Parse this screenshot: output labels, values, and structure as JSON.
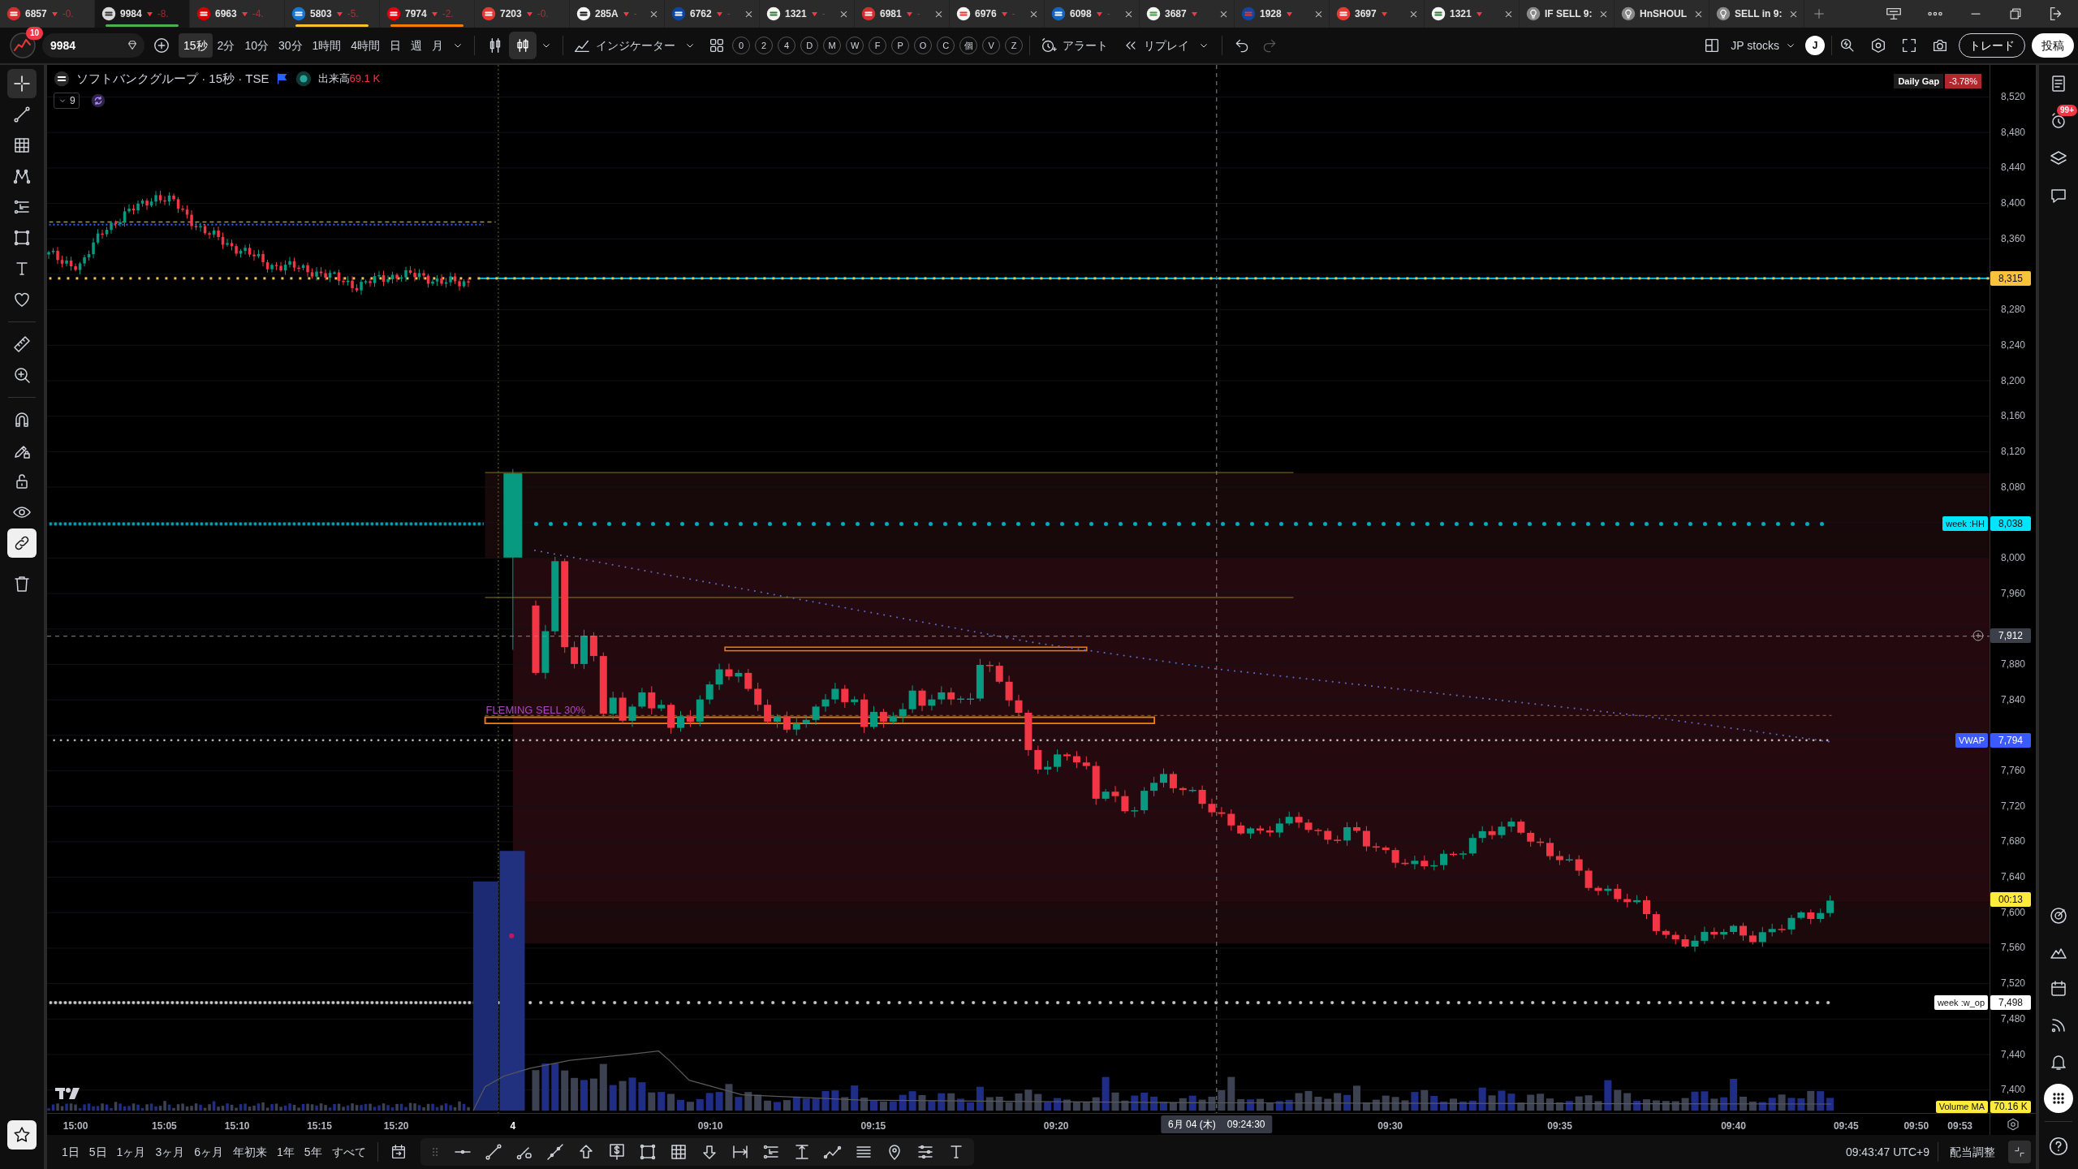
{
  "tabs": [
    {
      "kind": "symbol",
      "label": "6857",
      "change": "-0.",
      "selected": false,
      "closable": false
    },
    {
      "kind": "symbol",
      "label": "9984",
      "change": "-8.",
      "selected": true,
      "closable": false,
      "color": "#4caf50"
    },
    {
      "kind": "symbol",
      "label": "6963",
      "change": "-4.",
      "selected": false,
      "closable": false
    },
    {
      "kind": "symbol",
      "label": "5803",
      "change": "-5.",
      "selected": false,
      "closable": false,
      "color": "#fbc02d"
    },
    {
      "kind": "symbol",
      "label": "7974",
      "change": "-2.",
      "selected": false,
      "closable": false,
      "color": "#f57c00"
    },
    {
      "kind": "symbol",
      "label": "7203",
      "change": "-0.",
      "selected": false,
      "closable": false
    },
    {
      "kind": "symbol",
      "label": "285A",
      "change": "-",
      "selected": false,
      "closable": true
    },
    {
      "kind": "symbol",
      "label": "6762",
      "change": "-",
      "selected": false,
      "closable": true
    },
    {
      "kind": "symbol",
      "label": "1321",
      "change": "-",
      "selected": false,
      "closable": true
    },
    {
      "kind": "symbol",
      "label": "6981",
      "change": "-",
      "selected": false,
      "closable": true
    },
    {
      "kind": "symbol",
      "label": "6976",
      "change": "-",
      "selected": false,
      "closable": true
    },
    {
      "kind": "symbol",
      "label": "6098",
      "change": "-",
      "selected": false,
      "closable": true
    },
    {
      "kind": "symbol",
      "label": "3687",
      "selected": false,
      "closable": true
    },
    {
      "kind": "symbol",
      "label": "1928",
      "selected": false,
      "closable": true
    },
    {
      "kind": "symbol",
      "label": "3697",
      "selected": false,
      "closable": true
    },
    {
      "kind": "symbol",
      "label": "1321",
      "selected": false,
      "closable": true
    },
    {
      "kind": "idea",
      "label": "IF SELL 9:",
      "selected": false,
      "closable": true
    },
    {
      "kind": "idea",
      "label": "HnSHOUL",
      "selected": false,
      "closable": true
    },
    {
      "kind": "idea",
      "label": "SELL in 9:",
      "selected": false,
      "closable": true
    }
  ],
  "toolbar": {
    "notifications": "10",
    "symbol": "9984",
    "intervals": [
      {
        "label": "15秒",
        "selected": true
      },
      {
        "label": "2分",
        "selected": false
      },
      {
        "label": "10分",
        "selected": false
      },
      {
        "label": "30分",
        "selected": false
      },
      {
        "label": "1時間",
        "selected": false
      },
      {
        "label": "4時間",
        "selected": false
      },
      {
        "label": "日",
        "selected": false
      },
      {
        "label": "週",
        "selected": false
      },
      {
        "label": "月",
        "selected": false
      }
    ],
    "chart_types": [
      {
        "selected": false
      },
      {
        "selected": true
      }
    ],
    "indicators": "インジケーター",
    "shortcuts": [
      "0",
      "2",
      "4",
      "D",
      "M",
      "W",
      "F",
      "P",
      "O",
      "C",
      "個",
      "V",
      "Z"
    ],
    "alert": "アラート",
    "replay": "リプレイ",
    "layout": "JP stocks",
    "user_initial": "J",
    "trade": "トレード",
    "publish": "投稿"
  },
  "drawing_tools": {
    "tools": [
      {
        "selected": true
      },
      {
        "selected": false
      },
      {
        "selected": false
      },
      {
        "selected": false
      },
      {
        "selected": false
      },
      {
        "selected": false
      },
      {
        "selected": false
      },
      {
        "selected": false
      },
      {
        "selected": false
      },
      {
        "selected": false
      }
    ],
    "toggles": [
      {
        "on": false
      },
      {
        "on": false
      },
      {
        "on": false
      },
      {
        "on": false
      },
      {
        "on": true
      }
    ],
    "favorites": {
      "on": true
    }
  },
  "chart": {
    "legend": {
      "title": "ソフトバンクグループ · 15秒 · TSE",
      "volume_label": "出来高",
      "volume_value": "69.1 K",
      "indicator_count": "9"
    },
    "daily_gap": {
      "label": "Daily Gap",
      "value": "-3.78%"
    },
    "annotation": "FLEMING SELL 30%",
    "price_labels": [
      "8,520",
      "8,480",
      "8,440",
      "8,400",
      "8,360",
      "8,280",
      "8,240",
      "8,200",
      "8,160",
      "8,120",
      "8,080",
      "8,000",
      "7,960",
      "7,880",
      "7,840",
      "7,760",
      "7,720",
      "7,680",
      "7,640",
      "7,600",
      "7,560",
      "7,520",
      "7,480",
      "7,440",
      "7,400"
    ],
    "tags": [
      {
        "kind": "price",
        "value": "8,315",
        "color": "#f9c23c"
      },
      {
        "kind": "price",
        "label": "week :HH",
        "value": "8,038",
        "color": "#00e5ff"
      },
      {
        "kind": "crosshair",
        "value": "7,912"
      },
      {
        "kind": "price",
        "label": "VWAP",
        "value": "7,794",
        "color": "#3d5afe"
      },
      {
        "kind": "countdown",
        "value": "00:13",
        "color": "#ffeb3b"
      },
      {
        "kind": "price",
        "label": "week :w_op",
        "value": "7,498",
        "color": "#ffffff"
      },
      {
        "kind": "volume",
        "label": "Volume MA",
        "value": "70.16 K",
        "color": "#ffeb3b"
      }
    ],
    "time_labels": [
      {
        "text": "15:00",
        "kind": "time"
      },
      {
        "text": "15:05",
        "kind": "time"
      },
      {
        "text": "15:10",
        "kind": "time"
      },
      {
        "text": "15:15",
        "kind": "time"
      },
      {
        "text": "15:20",
        "kind": "time"
      },
      {
        "text": "4",
        "kind": "day"
      },
      {
        "text": "09:10",
        "kind": "time"
      },
      {
        "text": "09:15",
        "kind": "time"
      },
      {
        "text": "09:20",
        "kind": "time"
      },
      {
        "text": "09:30",
        "kind": "time"
      },
      {
        "text": "09:35",
        "kind": "time"
      },
      {
        "text": "09:40",
        "kind": "time"
      },
      {
        "text": "09:45",
        "kind": "time"
      },
      {
        "text": "09:50",
        "kind": "time"
      },
      {
        "text": "09:53",
        "kind": "time"
      }
    ],
    "crosshair_time": {
      "date": "6月 04 (木)",
      "time": "09:24:30"
    }
  },
  "right_sidebar": {
    "alerts_badge": "99+",
    "items": [
      {
        "selected": false
      },
      {
        "selected": false
      },
      {
        "selected": false
      },
      {
        "selected": false
      },
      {
        "selected": false
      },
      {
        "selected": false
      },
      {
        "selected": false
      },
      {
        "selected": false
      },
      {
        "selected": false
      },
      {
        "selected": true
      }
    ]
  },
  "bottom_bar": {
    "ranges": [
      "1日",
      "5日",
      "1ヶ月",
      "3ヶ月",
      "6ヶ月",
      "年初来",
      "1年",
      "5年",
      "すべて"
    ],
    "clock": "09:43:47 UTC+9",
    "adjustment": "配当調整"
  }
}
